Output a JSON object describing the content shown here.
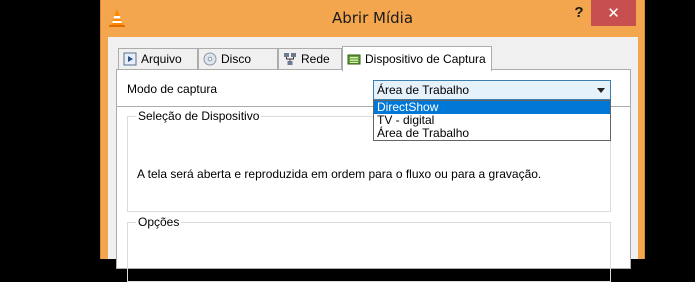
{
  "window": {
    "title": "Abrir Mídia",
    "help_label": "?",
    "close_label": "✕"
  },
  "tabs": [
    {
      "label": "Arquivo",
      "icon": "play-file-icon"
    },
    {
      "label": "Disco",
      "icon": "disc-icon"
    },
    {
      "label": "Rede",
      "icon": "network-icon"
    },
    {
      "label": "Dispositivo de Captura",
      "icon": "capture-device-icon",
      "active": true
    }
  ],
  "capture": {
    "mode_label": "Modo de captura",
    "selected_mode": "Área de Trabalho",
    "options": [
      "DirectShow",
      "TV - digital",
      "Área de Trabalho"
    ],
    "highlighted_option": "DirectShow"
  },
  "device_group": {
    "title": "Seleção de Dispositivo",
    "message": "A tela será aberta e reproduzida em ordem para o fluxo ou para a gravação."
  },
  "options_group": {
    "title": "Opções"
  },
  "colors": {
    "title_bar": "#f3a64d",
    "close_button": "#c74f4f",
    "selection": "#0078d7"
  }
}
